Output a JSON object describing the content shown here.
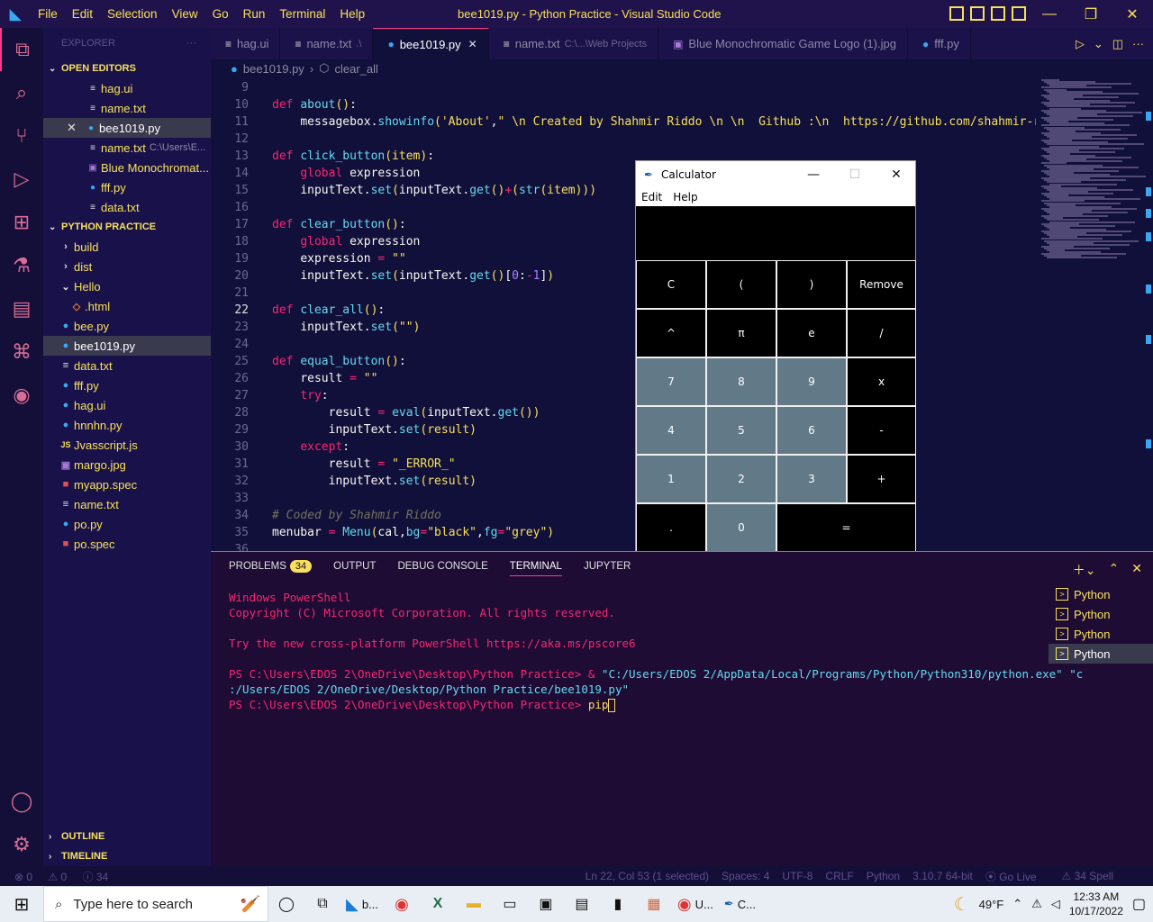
{
  "window": {
    "title": "bee1019.py - Python Practice - Visual Studio Code",
    "menu": [
      "File",
      "Edit",
      "Selection",
      "View",
      "Go",
      "Run",
      "Terminal",
      "Help"
    ]
  },
  "sidebar": {
    "header": "EXPLORER",
    "open_editors_label": "OPEN EDITORS",
    "open_editors": [
      {
        "name": "hag.ui",
        "icon": "ui-file-icon"
      },
      {
        "name": "name.txt",
        "icon": "text-file-icon"
      },
      {
        "name": "bee1019.py",
        "icon": "python-file-icon",
        "selected": true
      },
      {
        "name": "name.txt",
        "detail": "C:\\Users\\E...",
        "icon": "text-file-icon"
      },
      {
        "name": "Blue Monochromat...",
        "icon": "image-file-icon"
      },
      {
        "name": "fff.py",
        "icon": "python-file-icon"
      },
      {
        "name": "data.txt",
        "icon": "text-file-icon"
      }
    ],
    "folder_label": "PYTHON PRACTICE",
    "tree": [
      {
        "name": "build",
        "type": "folder"
      },
      {
        "name": "dist",
        "type": "folder"
      },
      {
        "name": "Hello",
        "type": "folder-open"
      },
      {
        "name": ".html",
        "type": "html"
      },
      {
        "name": "bee.py",
        "type": "py"
      },
      {
        "name": "bee1019.py",
        "type": "py",
        "selected": true
      },
      {
        "name": "data.txt",
        "type": "txt"
      },
      {
        "name": "fff.py",
        "type": "py"
      },
      {
        "name": "hag.ui",
        "type": "py"
      },
      {
        "name": "hnnhn.py",
        "type": "py"
      },
      {
        "name": "Jvasscript.js",
        "type": "js"
      },
      {
        "name": "margo.jpg",
        "type": "img"
      },
      {
        "name": "myapp.spec",
        "type": "spec"
      },
      {
        "name": "name.txt",
        "type": "txt"
      },
      {
        "name": "po.py",
        "type": "py"
      },
      {
        "name": "po.spec",
        "type": "spec"
      }
    ],
    "outline_label": "OUTLINE",
    "timeline_label": "TIMELINE"
  },
  "tabs": [
    {
      "label": "hag.ui"
    },
    {
      "label": "name.txt",
      "detail": ".\\"
    },
    {
      "label": "bee1019.py",
      "active": true
    },
    {
      "label": "name.txt",
      "detail": "C:\\...\\Web Projects"
    },
    {
      "label": "Blue Monochromatic Game Logo (1).jpg"
    },
    {
      "label": "fff.py"
    }
  ],
  "breadcrumb": {
    "file": "bee1019.py",
    "symbol": "clear_all"
  },
  "editor": {
    "lines": [
      {
        "n": "9",
        "html": ""
      },
      {
        "n": "10",
        "html": "<span class='kw'>def</span> <span class='fn'>about</span><span class='yel'>()</span><span class='pl'>:</span>"
      },
      {
        "n": "11",
        "html": "    <span class='pl'>messagebox.</span><span class='fn'>showinfo</span><span class='yel'>(</span><span class='str'>'About'</span><span class='pl'>,</span><span class='str'>\" \\n Created by Shahmir Riddo \\n \\n  Github :\\n  https://github.com/shahmir-ri</span>"
      },
      {
        "n": "12",
        "html": ""
      },
      {
        "n": "13",
        "html": "<span class='kw'>def</span> <span class='fn'>click_button</span><span class='yel'>(item)</span><span class='pl'>:</span>"
      },
      {
        "n": "14",
        "html": "    <span class='kw'>global</span> <span class='pl'>expression</span>"
      },
      {
        "n": "15",
        "html": "    <span class='pl'>inputText.</span><span class='fn'>set</span><span class='yel'>(</span><span class='pl'>inputText.</span><span class='fn'>get</span><span class='yel'>()</span><span class='op'>+</span><span class='yel'>(</span><span class='fn'>str</span><span class='yel'>(item)))</span>"
      },
      {
        "n": "16",
        "html": ""
      },
      {
        "n": "17",
        "html": "<span class='kw'>def</span> <span class='fn'>clear_button</span><span class='yel'>()</span><span class='pl'>:</span>"
      },
      {
        "n": "18",
        "html": "    <span class='kw'>global</span> <span class='pl'>expression</span>"
      },
      {
        "n": "19",
        "html": "    <span class='pl'>expression</span> <span class='op'>=</span> <span class='str'>\"\"</span>"
      },
      {
        "n": "20",
        "html": "    <span class='pl'>inputText.</span><span class='fn'>set</span><span class='yel'>(</span><span class='pl'>inputText.</span><span class='fn'>get</span><span class='yel'>()</span><span class='pl'>[</span><span class='num'>0</span><span class='pl'>:</span><span class='op'>-</span><span class='num'>1</span><span class='pl'>]</span><span class='yel'>)</span>"
      },
      {
        "n": "21",
        "html": ""
      },
      {
        "n": "22",
        "html": "<span class='kw'>def</span> <span class='fn'>clear_all</span><span class='yel'>()</span><span class='pl'>:</span>",
        "current": true
      },
      {
        "n": "23",
        "html": "    <span class='pl'>inputText.</span><span class='fn'>set</span><span class='yel'>(</span><span class='str'>\"\"</span><span class='yel'>)</span>"
      },
      {
        "n": "24",
        "html": ""
      },
      {
        "n": "25",
        "html": "<span class='kw'>def</span> <span class='fn'>equal_button</span><span class='yel'>()</span><span class='pl'>:</span>"
      },
      {
        "n": "26",
        "html": "    <span class='pl'>result</span> <span class='op'>=</span> <span class='str'>\"\"</span>"
      },
      {
        "n": "27",
        "html": "    <span class='kw'>try</span><span class='pl'>:</span>"
      },
      {
        "n": "28",
        "html": "        <span class='pl'>result</span> <span class='op'>=</span> <span class='fn'>eval</span><span class='yel'>(</span><span class='pl'>inputText.</span><span class='fn'>get</span><span class='yel'>())</span>"
      },
      {
        "n": "29",
        "html": "        <span class='pl'>inputText.</span><span class='fn'>set</span><span class='yel'>(result)</span>"
      },
      {
        "n": "30",
        "html": "    <span class='kw'>except</span><span class='pl'>:</span>"
      },
      {
        "n": "31",
        "html": "        <span class='pl'>result</span> <span class='op'>=</span> <span class='str'>\"_ERROR_\"</span>"
      },
      {
        "n": "32",
        "html": "        <span class='pl'>inputText.</span><span class='fn'>set</span><span class='yel'>(result)</span>"
      },
      {
        "n": "33",
        "html": ""
      },
      {
        "n": "34",
        "html": "<span class='cm'># Coded by Shahmir Riddo</span>"
      },
      {
        "n": "35",
        "html": "<span class='pl'>menubar</span> <span class='op'>=</span> <span class='fn'>Menu</span><span class='yel'>(</span><span class='pl'>cal,</span><span class='fn'>bg</span><span class='op'>=</span><span class='str'>\"black\"</span><span class='pl'>,</span><span class='fn'>fg</span><span class='op'>=</span><span class='str'>\"grey\"</span><span class='yel'>)</span>"
      },
      {
        "n": "36",
        "html": ""
      }
    ]
  },
  "calculator": {
    "title": "Calculator",
    "menu": [
      "Edit",
      "Help"
    ],
    "buttons": [
      {
        "label": "C",
        "style": "dark"
      },
      {
        "label": "(",
        "style": "dark"
      },
      {
        "label": ")",
        "style": "dark"
      },
      {
        "label": "Remove",
        "style": "dark"
      },
      {
        "label": "^",
        "style": "dark"
      },
      {
        "label": "π",
        "style": "dark"
      },
      {
        "label": "e",
        "style": "dark"
      },
      {
        "label": "/",
        "style": "dark"
      },
      {
        "label": "7",
        "style": "grey"
      },
      {
        "label": "8",
        "style": "grey"
      },
      {
        "label": "9",
        "style": "grey"
      },
      {
        "label": "x",
        "style": "dark"
      },
      {
        "label": "4",
        "style": "grey"
      },
      {
        "label": "5",
        "style": "grey"
      },
      {
        "label": "6",
        "style": "grey"
      },
      {
        "label": "-",
        "style": "dark"
      },
      {
        "label": "1",
        "style": "grey"
      },
      {
        "label": "2",
        "style": "grey"
      },
      {
        "label": "3",
        "style": "grey"
      },
      {
        "label": "+",
        "style": "dark"
      },
      {
        "label": ".",
        "style": "dark"
      },
      {
        "label": "0",
        "style": "grey"
      },
      {
        "label": "=",
        "style": "dark",
        "wide": true
      }
    ]
  },
  "panel": {
    "tabs": [
      {
        "label": "PROBLEMS",
        "badge": "34"
      },
      {
        "label": "OUTPUT"
      },
      {
        "label": "DEBUG CONSOLE"
      },
      {
        "label": "TERMINAL",
        "active": true
      },
      {
        "label": "JUPYTER"
      }
    ],
    "terminal": {
      "line1": "Windows PowerShell",
      "line2": "Copyright (C) Microsoft Corporation. All rights reserved.",
      "line3": "Try the new cross-platform PowerShell https://aka.ms/pscore6",
      "prompt1": "PS C:\\Users\\EDOS 2\\OneDrive\\Desktop\\Python Practice> & ",
      "cmd_a": "\"C:/Users/EDOS 2/AppData/Local/Programs/Python/Python310/python.exe\" \"c",
      "cmd_b": ":/Users/EDOS 2/OneDrive/Desktop/Python Practice/bee1019.py\"",
      "prompt2": "PS C:\\Users\\EDOS 2\\OneDrive\\Desktop\\Python Practice> ",
      "input": "pip"
    },
    "terminals": [
      "Python",
      "Python",
      "Python",
      "Python"
    ]
  },
  "status": {
    "errors": "0",
    "warnings": "0",
    "info": "34",
    "position": "Ln 22, Col 53 (1 selected)",
    "spaces": "Spaces: 4",
    "encoding": "UTF-8",
    "eol": "CRLF",
    "language": "Python",
    "interpreter": "3.10.7 64-bit",
    "golive": "Go Live",
    "spell": "34 Spell"
  },
  "taskbar": {
    "search_placeholder": "Type here to search",
    "vscode_label": "b...",
    "chrome_label": "U...",
    "calc_label": "C...",
    "weather": "49°F",
    "time": "12:33 AM",
    "date": "10/17/2022"
  }
}
